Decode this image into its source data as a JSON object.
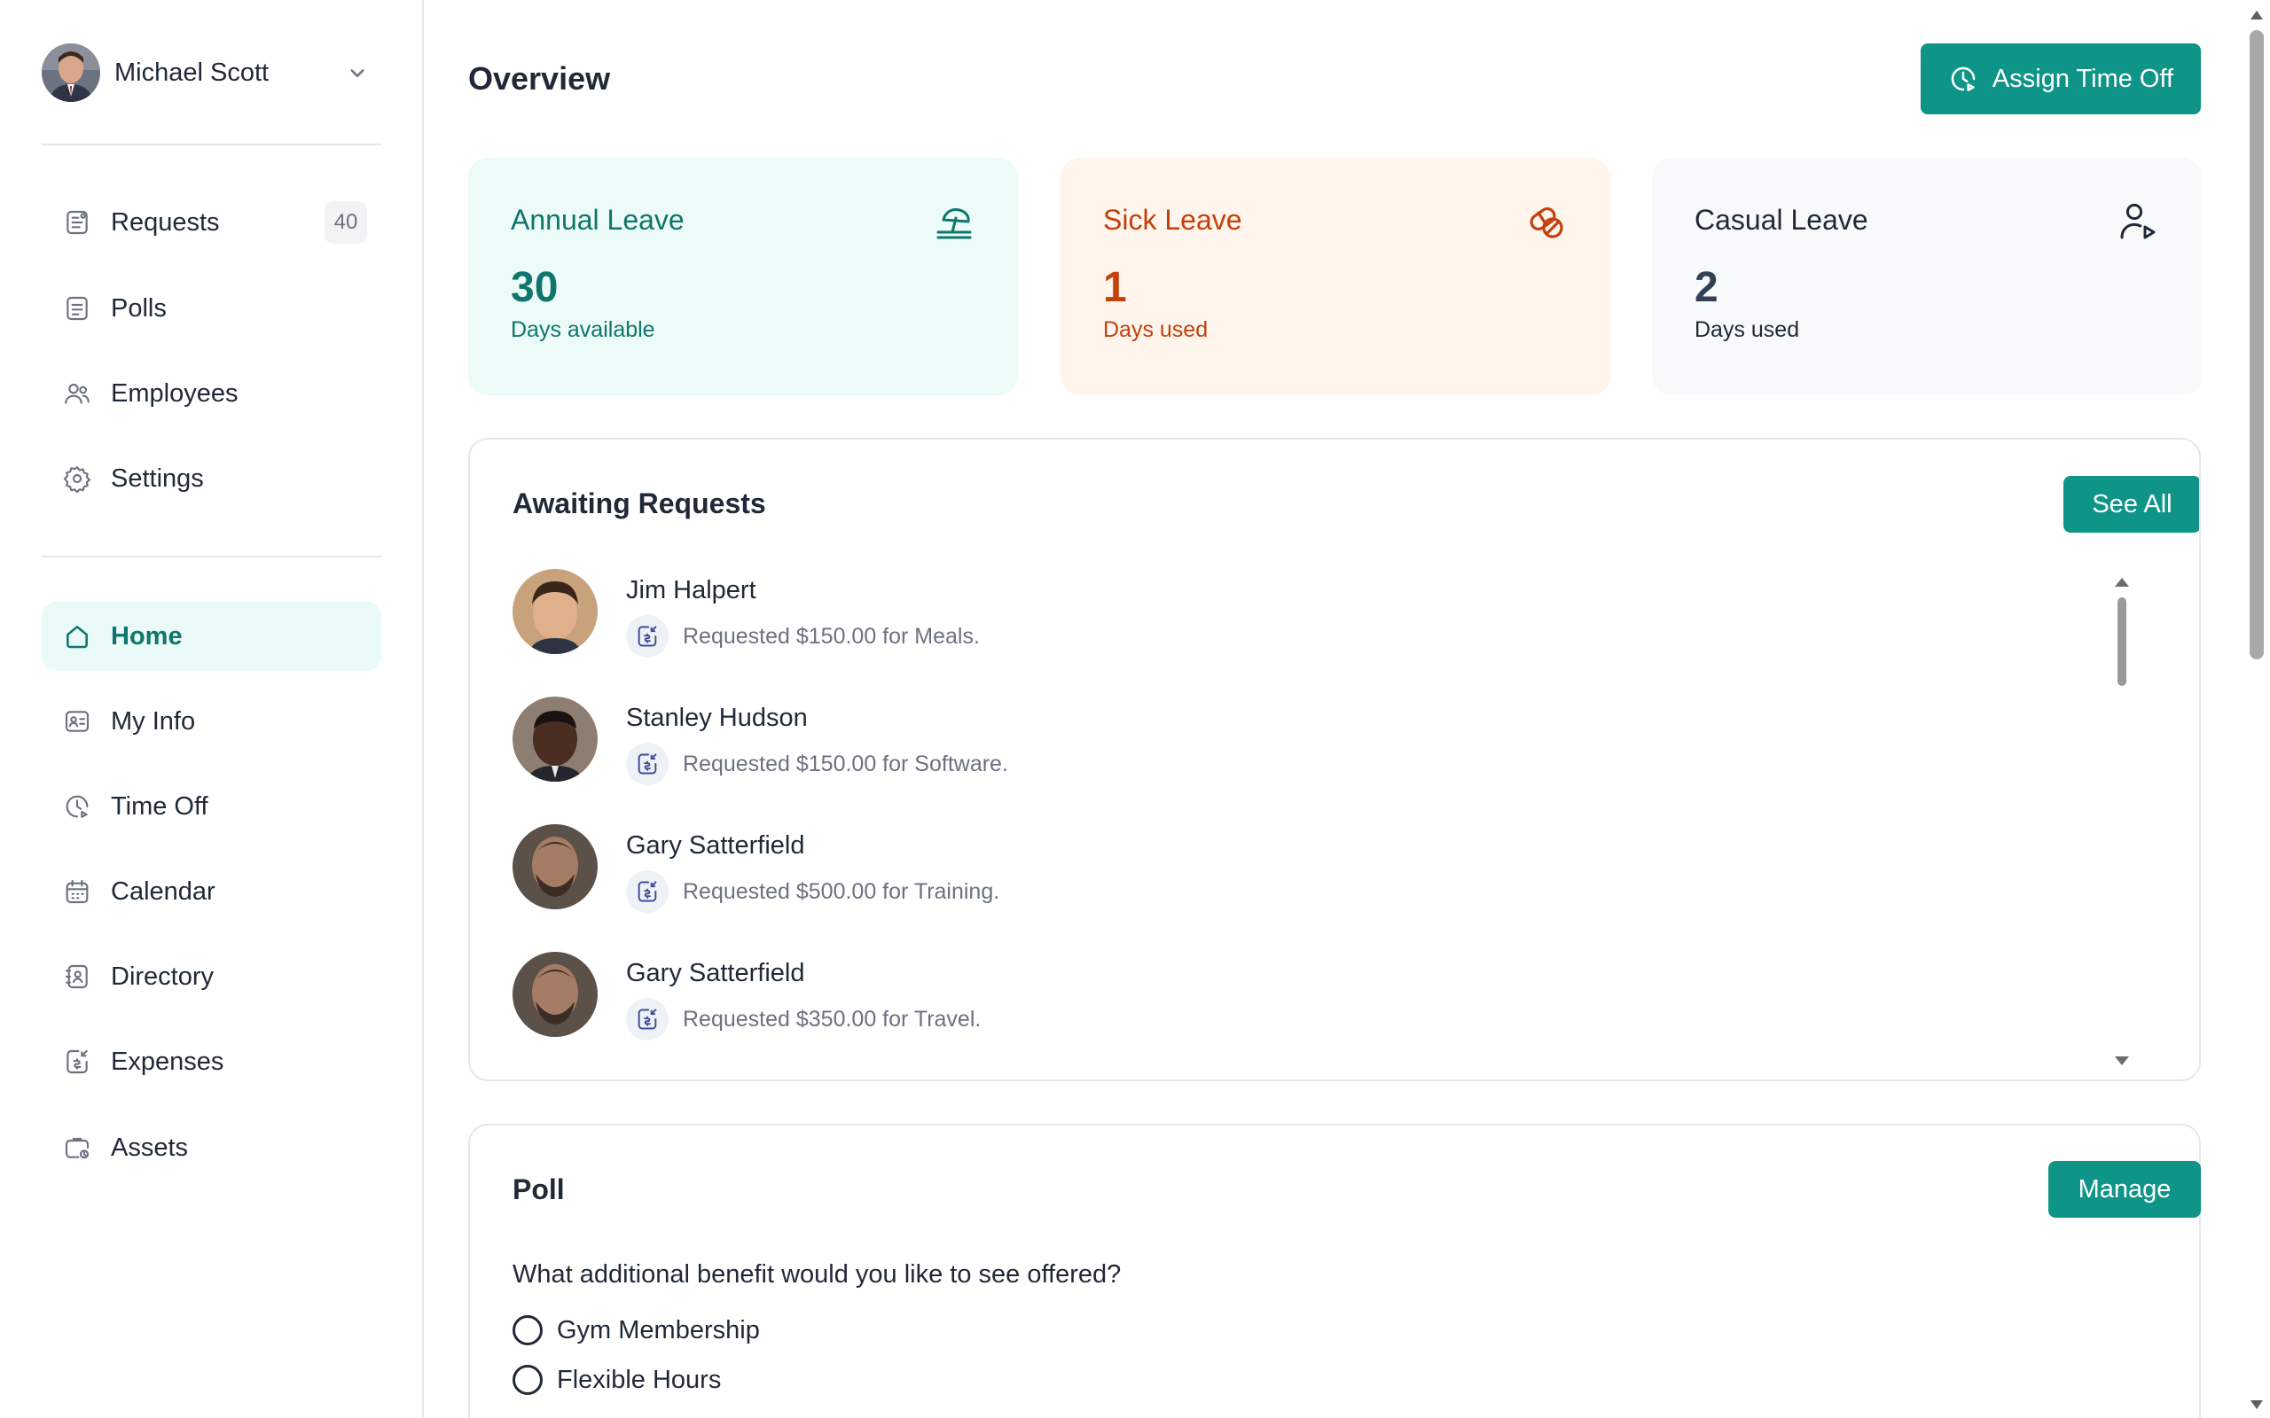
{
  "profile": {
    "name": "Michael Scott"
  },
  "nav_top": [
    {
      "label": "Requests",
      "badge": "40",
      "icon": "requests-icon"
    },
    {
      "label": "Polls",
      "icon": "polls-icon"
    },
    {
      "label": "Employees",
      "icon": "employees-icon"
    },
    {
      "label": "Settings",
      "icon": "gear-icon"
    }
  ],
  "nav_main": [
    {
      "label": "Home",
      "icon": "home-icon",
      "active": true
    },
    {
      "label": "My Info",
      "icon": "id-card-icon"
    },
    {
      "label": "Time Off",
      "icon": "clock-icon"
    },
    {
      "label": "Calendar",
      "icon": "calendar-icon"
    },
    {
      "label": "Directory",
      "icon": "contacts-icon"
    },
    {
      "label": "Expenses",
      "icon": "expense-icon"
    },
    {
      "label": "Assets",
      "icon": "briefcase-icon"
    }
  ],
  "header": {
    "title": "Overview",
    "assign_label": "Assign Time Off"
  },
  "leave_cards": [
    {
      "title": "Annual Leave",
      "value": "30",
      "sub": "Days available",
      "icon": "beach-icon",
      "color": "#0f766e"
    },
    {
      "title": "Sick Leave",
      "value": "1",
      "sub": "Days used",
      "icon": "pill-icon",
      "color": "#c2410c"
    },
    {
      "title": "Casual Leave",
      "value": "2",
      "sub": "Days used",
      "icon": "user-play-icon",
      "color": "#1f2937"
    }
  ],
  "awaiting": {
    "title": "Awaiting Requests",
    "see_all_label": "See All",
    "requests": [
      {
        "name": "Jim Halpert",
        "text": "Requested $150.00 for Meals."
      },
      {
        "name": "Stanley Hudson",
        "text": "Requested $150.00 for Software."
      },
      {
        "name": "Gary Satterfield",
        "text": "Requested $500.00 for Training."
      },
      {
        "name": "Gary Satterfield",
        "text": "Requested $350.00 for Travel."
      }
    ]
  },
  "poll": {
    "title": "Poll",
    "manage_label": "Manage",
    "question": "What additional benefit would you like to see offered?",
    "options": [
      "Gym Membership",
      "Flexible Hours"
    ]
  },
  "colors": {
    "accent": "#0f9488",
    "accent_dark": "#0f766e",
    "sick": "#c2410c"
  }
}
